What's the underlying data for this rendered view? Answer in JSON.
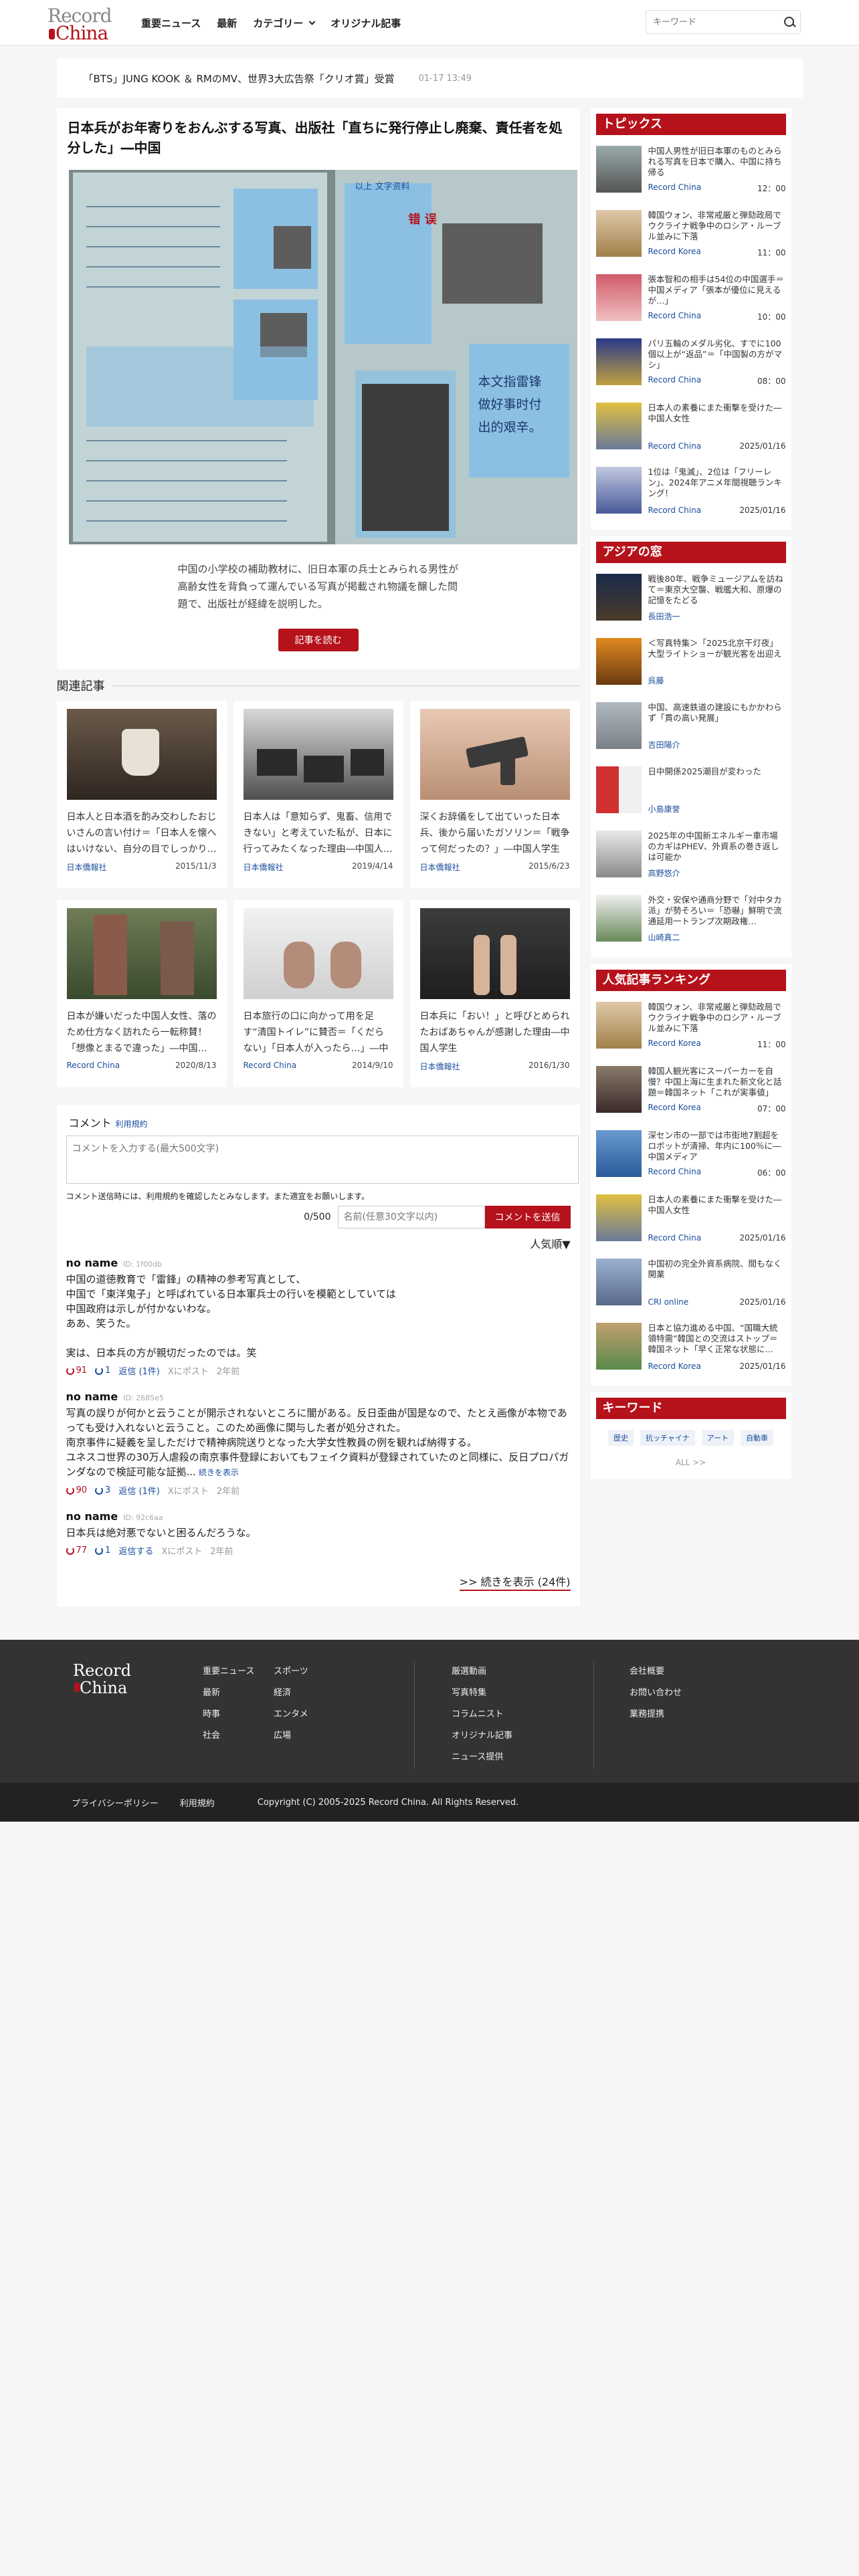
{
  "header": {
    "logo_line1": "Record",
    "logo_line2": "China",
    "nav": [
      "重要ニュース",
      "最新",
      "カテゴリー",
      "オリジナル記事"
    ],
    "search_placeholder": "キーワード"
  },
  "ticker": {
    "text": "「BTS」JUNG KOOK ＆ RMのMV、世界3大広告祭「クリオ賞」受賞",
    "date": "01-17 13:49"
  },
  "article": {
    "title": "日本兵がお年寄りをおんぶする写真、出版社「直ちに発行停止し廃棄、責任者を処分した」―中国",
    "caption": "中国の小学校の補助教材に、旧日本軍の兵士とみられる男性が高齢女性を背負って運んでいる写真が掲載され物議を醸した問題で、出版社が経緯を説明した。",
    "read_button": "記事を読む",
    "photo_text_right": [
      "本文指雷锋",
      "做好事时付",
      "出的艰辛。"
    ],
    "photo_text_top": "错 误",
    "photo_text_top2": "以上 文字资料"
  },
  "related": {
    "heading": "関連記事",
    "items": [
      {
        "title": "日本人と日本酒を酌み交わしたおじいさんの言い付け＝「日本人を懐へはいけない、自分の目でしっかり…",
        "source": "日本僑報社",
        "date": "2015/11/3"
      },
      {
        "title": "日本人は「意知らず、鬼畜、信用できない」と考えていた私が、日本に行ってみたくなった理由―中国人…",
        "source": "日本僑報社",
        "date": "2019/4/14"
      },
      {
        "title": "深くお辞儀をして出ていった日本兵、後から届いたガソリン＝「戦争って何だったの？」―中国人学生",
        "source": "日本僑報社",
        "date": "2015/6/23"
      },
      {
        "title": "日本が嫌いだった中国人女性、落の ため仕方なく訪れたら一転称賛！「想像とまるで違った」―中国…",
        "source": "Record China",
        "date": "2020/8/13"
      },
      {
        "title": "日本旅行の口に向かって用を足す“清国トイレ”に賛否＝「くだらない」「日本人が入ったら…」―中国ネ…",
        "source": "Record China",
        "date": "2014/9/10"
      },
      {
        "title": "日本兵に「おい！」と呼びとめられたおばあちゃんが感謝した理由―中国人学生",
        "source": "日本僑報社",
        "date": "2016/1/30"
      }
    ]
  },
  "comments": {
    "heading": "コメント",
    "terms_link": "利用規約",
    "placeholder": "コメントを入力する(最大500文字)",
    "note": "コメント送信時には、利用規約を確認したとみなします。また適宜をお願いします。",
    "count": "0/500",
    "name_placeholder": "名前(任意30文字以内)",
    "send_button": "コメントを送信",
    "sort": "人気順▼",
    "items": [
      {
        "user": "no name",
        "id": "ID: 1f00db",
        "body": "中国の道徳教育で「雷鋒」の精神の参考写真として、\n中国で「東洋鬼子」と呼ばれている日本軍兵士の行いを模範としていては\n中国政府は示しが付かないわな。\nああ、笑うた。\n\n実は、日本兵の方が親切だったのでは。笑",
        "more": "",
        "good": "91",
        "bad": "1",
        "reply": "返信 (1件)",
        "xpost": "Xにポスト",
        "ago": "2年前"
      },
      {
        "user": "no name",
        "id": "ID: 2685e5",
        "body": "写真の誤りが何かと云うことが開示されないところに闇がある。反日歪曲が国是なので、たとえ画像が本物であっても受け入れないと云うこと。このため画像に関与した者が処分された。\n南京事件に疑義を呈しただけで精神病院送りとなった大学女性教員の例を観れば納得する。\nユネスコ世界の30万人虐殺の南京事件登録においてもフェイク資料が登録されていたのと同様に、反日プロパガンダなので検証可能な証拠...",
        "more": "続きを表示",
        "good": "90",
        "bad": "3",
        "reply": "返信 (1件)",
        "xpost": "Xにポスト",
        "ago": "2年前"
      },
      {
        "user": "no name",
        "id": "ID: 92c6aa",
        "body": "日本兵は絶対悪でないと困るんだろうな。",
        "more": "",
        "good": "77",
        "bad": "1",
        "reply": "返信する",
        "xpost": "Xにポスト",
        "ago": "2年前"
      }
    ],
    "show_more": ">> 続きを表示 (24件)"
  },
  "sidebar": {
    "topics": {
      "heading": "トピックス",
      "items": [
        {
          "title": "中国人男性が旧日本軍のものとみられる写真を日本で購入、中国に持ち帰る",
          "source": "Record China",
          "date": "12：00"
        },
        {
          "title": "韓国ウォン、非常戒厳と弾劾政局でウクライナ戦争中のロシア・ルーブル並みに下落",
          "source": "Record Korea",
          "date": "11：00"
        },
        {
          "title": "張本智和の相手は54位の中国選手＝中国メディア「張本が優位に見えるが…」",
          "source": "Record China",
          "date": "10：00"
        },
        {
          "title": "パリ五輪のメダル劣化、すでに100個以上が“返品”＝「中国製の方がマシ」",
          "source": "Record China",
          "date": "08：00"
        },
        {
          "title": "日本人の素養にまた衝撃を受けた―中国人女性",
          "source": "Record China",
          "date": "2025/01/16"
        },
        {
          "title": "1位は「鬼滅」、2位は「フリーレン」、2024年アニメ年間視聴ランキング！",
          "source": "Record China",
          "date": "2025/01/16"
        }
      ]
    },
    "asia": {
      "heading": "アジアの窓",
      "items": [
        {
          "title": "戦後80年、戦争ミュージアムを訪ねて＝東京大空襲、戦艦大和、原爆の記憶をたどる",
          "source": "長田浩一",
          "date": ""
        },
        {
          "title": "＜写真特集＞「2025北京干灯夜」大型ライトショーが観光客を出迎え",
          "source": "呉藤",
          "date": ""
        },
        {
          "title": "中国、高速鉄道の建設にもかかわらず「貫の高い発展」",
          "source": "吉田陽介",
          "date": ""
        },
        {
          "title": "日中開係2025潮目が変わった",
          "source": "小島康誉",
          "date": ""
        },
        {
          "title": "2025年の中国新エネルギー車市場のカギはPHEV、外資系の巻き返しは可能か",
          "source": "高野悠介",
          "date": ""
        },
        {
          "title": "外交・安保や通商分野で「対中タカ派」が勢そろい＝「恐嚇」鮮明で流通延用一トランプ次期政権…",
          "source": "山崎真二",
          "date": ""
        }
      ]
    },
    "ranking": {
      "heading": "人気記事ランキング",
      "items": [
        {
          "title": "韓国ウォン、非常戒厳と弾劾政局でウクライナ戦争中のロシア・ルーブル並みに下落",
          "source": "Record Korea",
          "date": "11：00"
        },
        {
          "title": "韓国人観光客にスーパーカーを自慢？中国上海に生まれた新文化と話題＝韓国ネット「これが実事値」",
          "source": "Record Korea",
          "date": "07：00"
        },
        {
          "title": "深セン市の一部では市街地7割超をロボットが清掃、年内に100％に―中国メディア",
          "source": "Record China",
          "date": "06：00"
        },
        {
          "title": "日本人の素養にまた衝撃を受けた―中国人女性",
          "source": "Record China",
          "date": "2025/01/16"
        },
        {
          "title": "中国初の完全外資系病院、間もなく開業",
          "source": "CRI online",
          "date": "2025/01/16"
        },
        {
          "title": "日本と協力進める中国、“国職大統領特需”韓国との交流はストップ＝韓国ネット「早く正常な状態に…",
          "source": "Record Korea",
          "date": "2025/01/16"
        }
      ]
    },
    "keywords": {
      "heading": "キーワード",
      "items": [
        "歴史",
        "抗ッチャイナ",
        "アート",
        "自動車"
      ],
      "all": "ALL >>"
    }
  },
  "footer": {
    "logo_line1": "Record",
    "logo_line2": "China",
    "col1": [
      "重要ニュース",
      "最新",
      "時事",
      "社会"
    ],
    "col2": [
      "スポーツ",
      "経済",
      "エンタメ",
      "広場"
    ],
    "col3": [
      "厳選動画",
      "写真特集",
      "コラムニスト",
      "オリジナル記事",
      "ニュース提供"
    ],
    "col4": [
      "会社概要",
      "お問い合わせ",
      "業務提携"
    ],
    "privacy": "プライバシーポリシー",
    "terms": "利用規約",
    "copyright": "Copyright (C) 2005-2025 Record China. All Rights Reserved."
  },
  "colors": {
    "accent": "#b5121b",
    "link": "#1a4d9c"
  }
}
